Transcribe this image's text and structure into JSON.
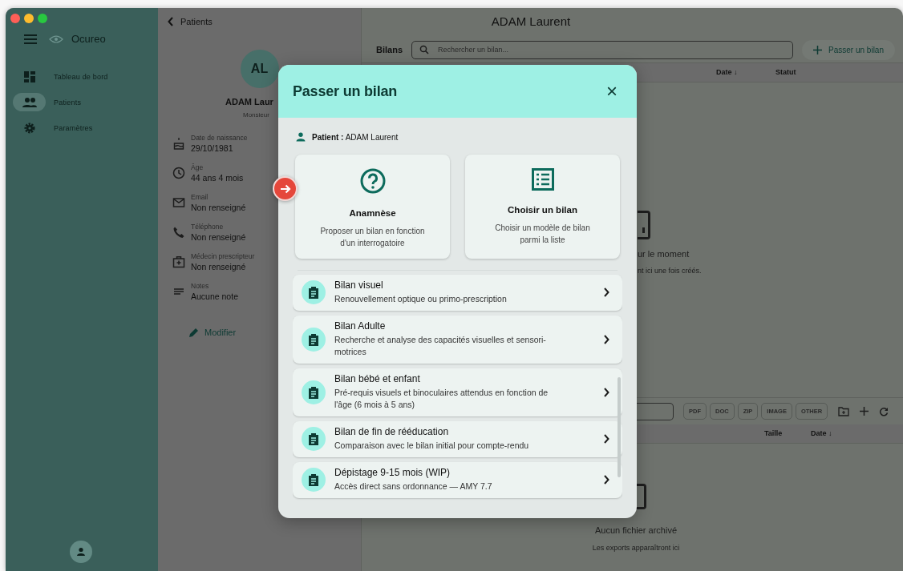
{
  "sidebar": {
    "app_name": "Ocureo",
    "items": [
      {
        "label": "Tableau de bord",
        "kind": "dashboard",
        "selected": false
      },
      {
        "label": "Patients",
        "kind": "people",
        "selected": true
      },
      {
        "label": "Paramètres",
        "kind": "settings",
        "selected": false
      }
    ]
  },
  "patient_panel": {
    "back": "Patients",
    "initials": "AL",
    "name": "ADAM Laur",
    "civility": "Monsieur",
    "fields": [
      {
        "kind": "birthday",
        "label": "Date de naissance",
        "value": "29/10/1981"
      },
      {
        "kind": "clock",
        "label": "Âge",
        "value": "44 ans 4 mois"
      },
      {
        "kind": "mail",
        "label": "Email",
        "value": "Non renseigné"
      },
      {
        "kind": "phone",
        "label": "Téléphone",
        "value": "Non renseigné"
      },
      {
        "kind": "medic",
        "label": "Médecin prescripteur",
        "value": "Non renseigné"
      },
      {
        "kind": "notes",
        "label": "Notes",
        "value": "Aucune note"
      }
    ],
    "edit_button": "Modifier"
  },
  "title": "ADAM Laurent",
  "bilans": {
    "title": "Bilans",
    "search": {
      "placeholder": "Rechercher un bilan..."
    },
    "new_button": "Passer un bilan",
    "columns": [
      "Date ↓",
      "Statut"
    ],
    "empty_title": "ur le moment",
    "empty_text": "nt ici une fois créés."
  },
  "files": {
    "filters": [
      "PDF",
      "DOC",
      "ZIP",
      "IMAGE",
      "OTHER"
    ],
    "columns": [
      "Taille",
      "Date ↓"
    ],
    "empty_title": "Aucun fichier archivé",
    "empty_text": "Les exports apparaîtront ici"
  },
  "modal": {
    "title": "Passer un bilan",
    "close": "×",
    "patient": "**Patient :** ADAM Laurent",
    "options": [
      {
        "kind": "question",
        "title": "Anamnèse",
        "description": "Proposer un bilan en fonction d'un interrogatoire"
      },
      {
        "kind": "list",
        "title": "Choisir un bilan",
        "description": "Choisir un modèle de bilan parmi la liste"
      }
    ],
    "items": [
      {
        "title": "Bilan visuel",
        "description": "Renouvellement optique ou primo-prescription"
      },
      {
        "title": "Bilan Adulte",
        "description": "Recherche et analyse des capacités visuelles et sensori-motrices"
      },
      {
        "title": "Bilan bébé et enfant",
        "description": "Pré-requis visuels et binoculaires attendus en fonction de l'âge (6 mois à 5 ans)"
      },
      {
        "title": "Bilan de fin de rééducation",
        "description": "Comparaison avec le bilan initial pour compte-rendu"
      },
      {
        "title": "Dépistage 9-15 mois (WIP)",
        "description": "Accès direct sans ordonnance — AMY 7.7"
      }
    ]
  }
}
